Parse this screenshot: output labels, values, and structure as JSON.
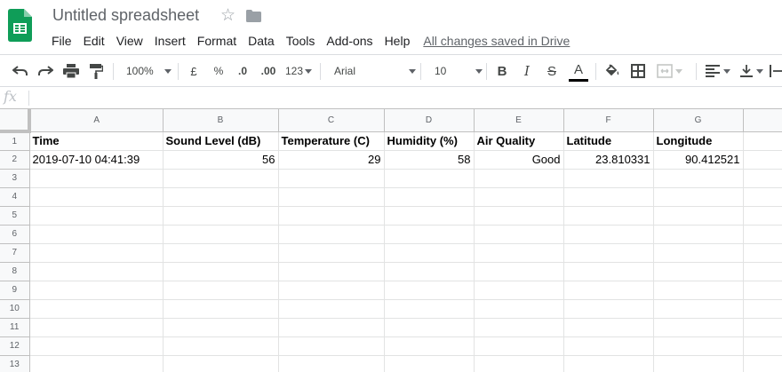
{
  "app": {
    "title": "Untitled spreadsheet",
    "save_status": "All changes saved in Drive",
    "brand_color": "#0f9d58"
  },
  "menu": {
    "items": [
      "File",
      "Edit",
      "View",
      "Insert",
      "Format",
      "Data",
      "Tools",
      "Add-ons",
      "Help"
    ]
  },
  "toolbar": {
    "undo_icon": "undo-icon",
    "redo_icon": "redo-icon",
    "print_icon": "print-icon",
    "paint_format_icon": "paint-format-icon",
    "zoom": "100%",
    "currency": "£",
    "percent": "%",
    "decrease_decimal": ".0",
    "increase_decimal": ".00",
    "more_formats": "123",
    "font": "Arial",
    "font_size": "10",
    "bold": "B",
    "italic": "I",
    "strikethrough": "S",
    "text_color": "A"
  },
  "formula_bar": {
    "label": "fx",
    "value": ""
  },
  "sheet": {
    "columns": [
      "A",
      "B",
      "C",
      "D",
      "E",
      "F",
      "G"
    ],
    "row_numbers": [
      "1",
      "2",
      "3",
      "4",
      "5",
      "6",
      "7",
      "8",
      "9",
      "10",
      "11",
      "12",
      "13"
    ],
    "rows": [
      [
        "Time",
        "Sound Level (dB)",
        "Temperature (C)",
        "Humidity (%)",
        "Air Quality",
        "Latitude",
        "Longitude"
      ],
      [
        "2019-07-10 04:41:39",
        "56",
        "29",
        "58",
        "Good",
        "23.810331",
        "90.412521"
      ]
    ]
  }
}
